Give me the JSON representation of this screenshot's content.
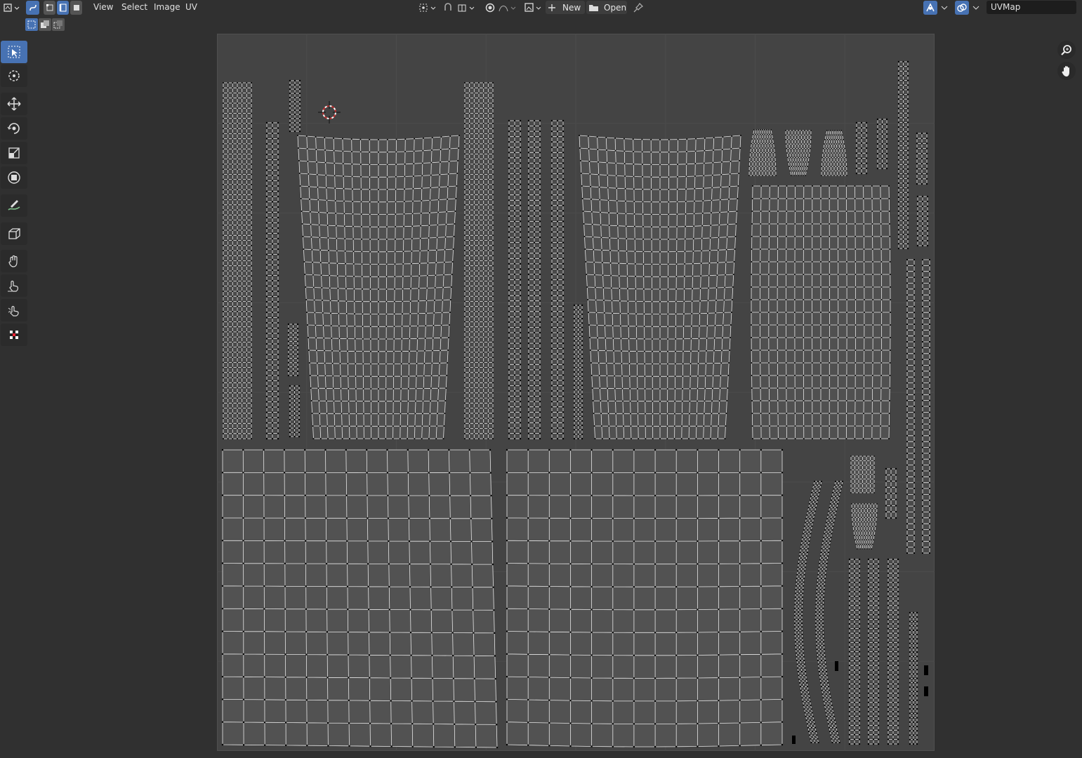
{
  "header": {
    "menus": {
      "view": "View",
      "select": "Select",
      "image": "Image",
      "uv": "UV"
    },
    "new_label": "New",
    "open_label": "Open",
    "uvmap_label": "UVMap"
  },
  "colors": {
    "accent": "#4772b3",
    "background": "#303030",
    "uv_area": "#444444",
    "grid": "#4b4b4b",
    "edge": "#e6e6e6",
    "vertex": "#000000",
    "cursor": "#c03030"
  },
  "icons": [
    "editor-type-icon",
    "uv-sync-icon",
    "vertex-select-icon",
    "edge-select-icon",
    "face-select-icon",
    "pivot-icon",
    "snap-icon",
    "proportional-icon",
    "image-browse-icon",
    "new-icon",
    "folder-icon",
    "pin-icon",
    "gizmo-icon",
    "overlay-icon",
    "select-box-icon",
    "cursor-icon",
    "move-icon",
    "rotate-icon",
    "scale-icon",
    "transform-icon",
    "annotate-icon",
    "rip-icon",
    "grab-icon",
    "relax-icon",
    "pinch-icon",
    "sample-icon",
    "zoom-icon",
    "pan-icon"
  ]
}
